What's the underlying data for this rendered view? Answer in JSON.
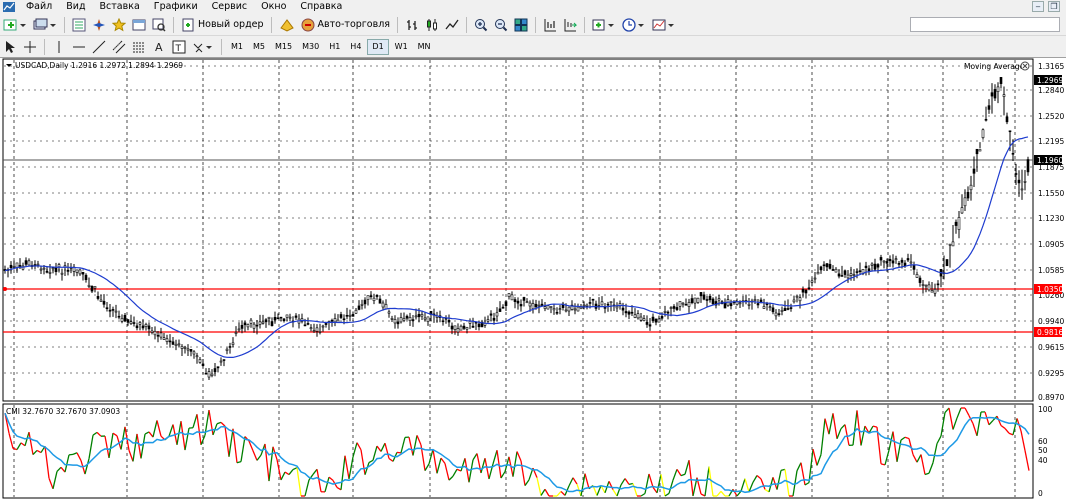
{
  "menu": {
    "items": [
      "Файл",
      "Вид",
      "Вставка",
      "Графики",
      "Сервис",
      "Окно",
      "Справка"
    ]
  },
  "toolbar": {
    "new_order_label": "Новый ордер",
    "auto_trading_label": "Авто-торговля",
    "timeframes": [
      "M1",
      "M5",
      "M15",
      "M30",
      "H1",
      "H4",
      "D1",
      "W1",
      "MN"
    ],
    "active_timeframe": "D1"
  },
  "chart": {
    "header": "USDCAD,Daily 1.2916 1.2972 1.2894 1.2969",
    "indicator_label": "Moving Average",
    "price_labels": [
      "1.3165",
      "1.2840",
      "1.2520",
      "1.2195",
      "1.1875",
      "1.1550",
      "1.1230",
      "1.0905",
      "1.0585",
      "1.0260",
      "0.9940",
      "0.9615",
      "0.9295",
      "0.8970"
    ],
    "current_price": "1.2969",
    "hline_price": "1.1960",
    "red_line_upper": "1.0350",
    "red_line_lower": "0.9816",
    "colors": {
      "moving_average": "#1e3ccf",
      "red_lines": "#ff0000",
      "cci_up": "#008000",
      "cci_down": "#ff0000",
      "cci_signal": "#1e9ae6",
      "cci_neutral": "#ffff00"
    }
  },
  "subwindow": {
    "header": "CMI 32.7670 32.7670 37.0903",
    "scale_labels": [
      "100",
      "60",
      "50",
      "40",
      "0"
    ]
  }
}
